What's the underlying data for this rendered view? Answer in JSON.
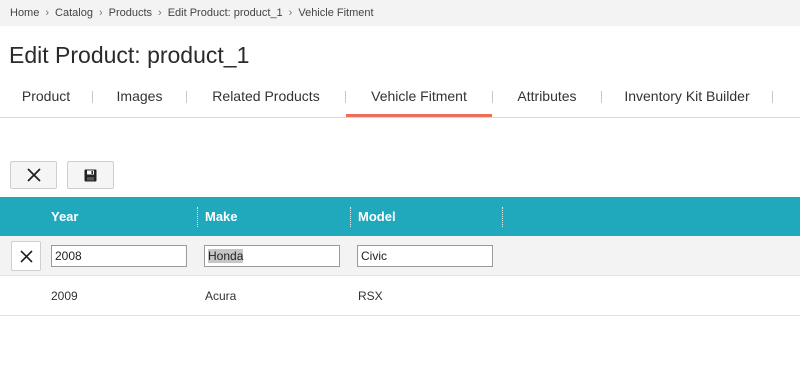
{
  "breadcrumb": {
    "items": [
      "Home",
      "Catalog",
      "Products",
      "Edit Product: product_1",
      "Vehicle Fitment"
    ],
    "separator": "›"
  },
  "page": {
    "title": "Edit Product: product_1"
  },
  "tabs": [
    {
      "label": "Product"
    },
    {
      "label": "Images"
    },
    {
      "label": "Related Products"
    },
    {
      "label": "Vehicle Fitment",
      "active": true
    },
    {
      "label": "Attributes"
    },
    {
      "label": "Inventory Kit Builder"
    }
  ],
  "toolbar": {
    "cancel_icon": "close-icon",
    "save_icon": "floppy-disk-icon"
  },
  "grid": {
    "columns": [
      "Year",
      "Make",
      "Model"
    ],
    "edit_row": {
      "year": "2008",
      "make": "Honda",
      "model": "Civic"
    },
    "rows": [
      {
        "year": "2009",
        "make": "Acura",
        "model": "RSX"
      }
    ]
  },
  "colors": {
    "header_bg": "#20a8bc",
    "active_tab_underline": "#ee6e57",
    "breadcrumb_bg": "#f3f3f3"
  }
}
